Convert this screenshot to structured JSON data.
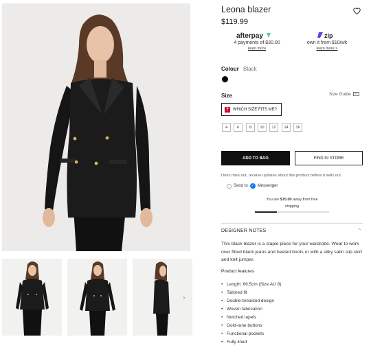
{
  "product": {
    "title": "Leona blazer",
    "price": "$119.99"
  },
  "payments": [
    {
      "brand": "afterpay",
      "text": "4 payments of $30.00",
      "link": "learn more"
    },
    {
      "brand": "zip",
      "text": "own it from $10/wk",
      "link": "learn more >"
    }
  ],
  "colour": {
    "label": "Colour",
    "value": "Black",
    "swatch_color": "#000000"
  },
  "size": {
    "label": "Size",
    "guide_label": "Size Guide",
    "which_size_label": "WHICH SIZE FITS ME?",
    "options": [
      "4",
      "6",
      "8",
      "10",
      "12",
      "14",
      "16"
    ]
  },
  "actions": {
    "add_to_bag": "ADD TO BAG",
    "find_in_store": "FIND IN STORE"
  },
  "updates": {
    "text": "Don't miss out, receive updates about this product before it sells out",
    "send_to": "Send to",
    "messenger": "Messenger"
  },
  "shipping": {
    "prefix": "You are ",
    "amount": "$75.00",
    "suffix": " away from free",
    "line2": "shipping",
    "progress": 0.3
  },
  "designer_notes": {
    "title": "DESIGNER NOTES",
    "description": "This black blazer is a staple piece for your wardrobe. Wear to work over fitted black jeans and heeled boots or with a silky satin slip skirt and knit jumper.",
    "features_title": "Product features",
    "features": [
      "Length: 66.5cm (Size AU 8)",
      "Tailored fit",
      "Double-breasted design",
      "Woven fabrication",
      "Notched lapels",
      "Gold-tone buttons",
      "Functional pockets",
      "Fully lined"
    ]
  },
  "colors": {
    "accent": "#111111",
    "afterpay_mint": "#b2fce4",
    "zip_purple": "#6b3cde",
    "alert_red": "#c8102e"
  }
}
